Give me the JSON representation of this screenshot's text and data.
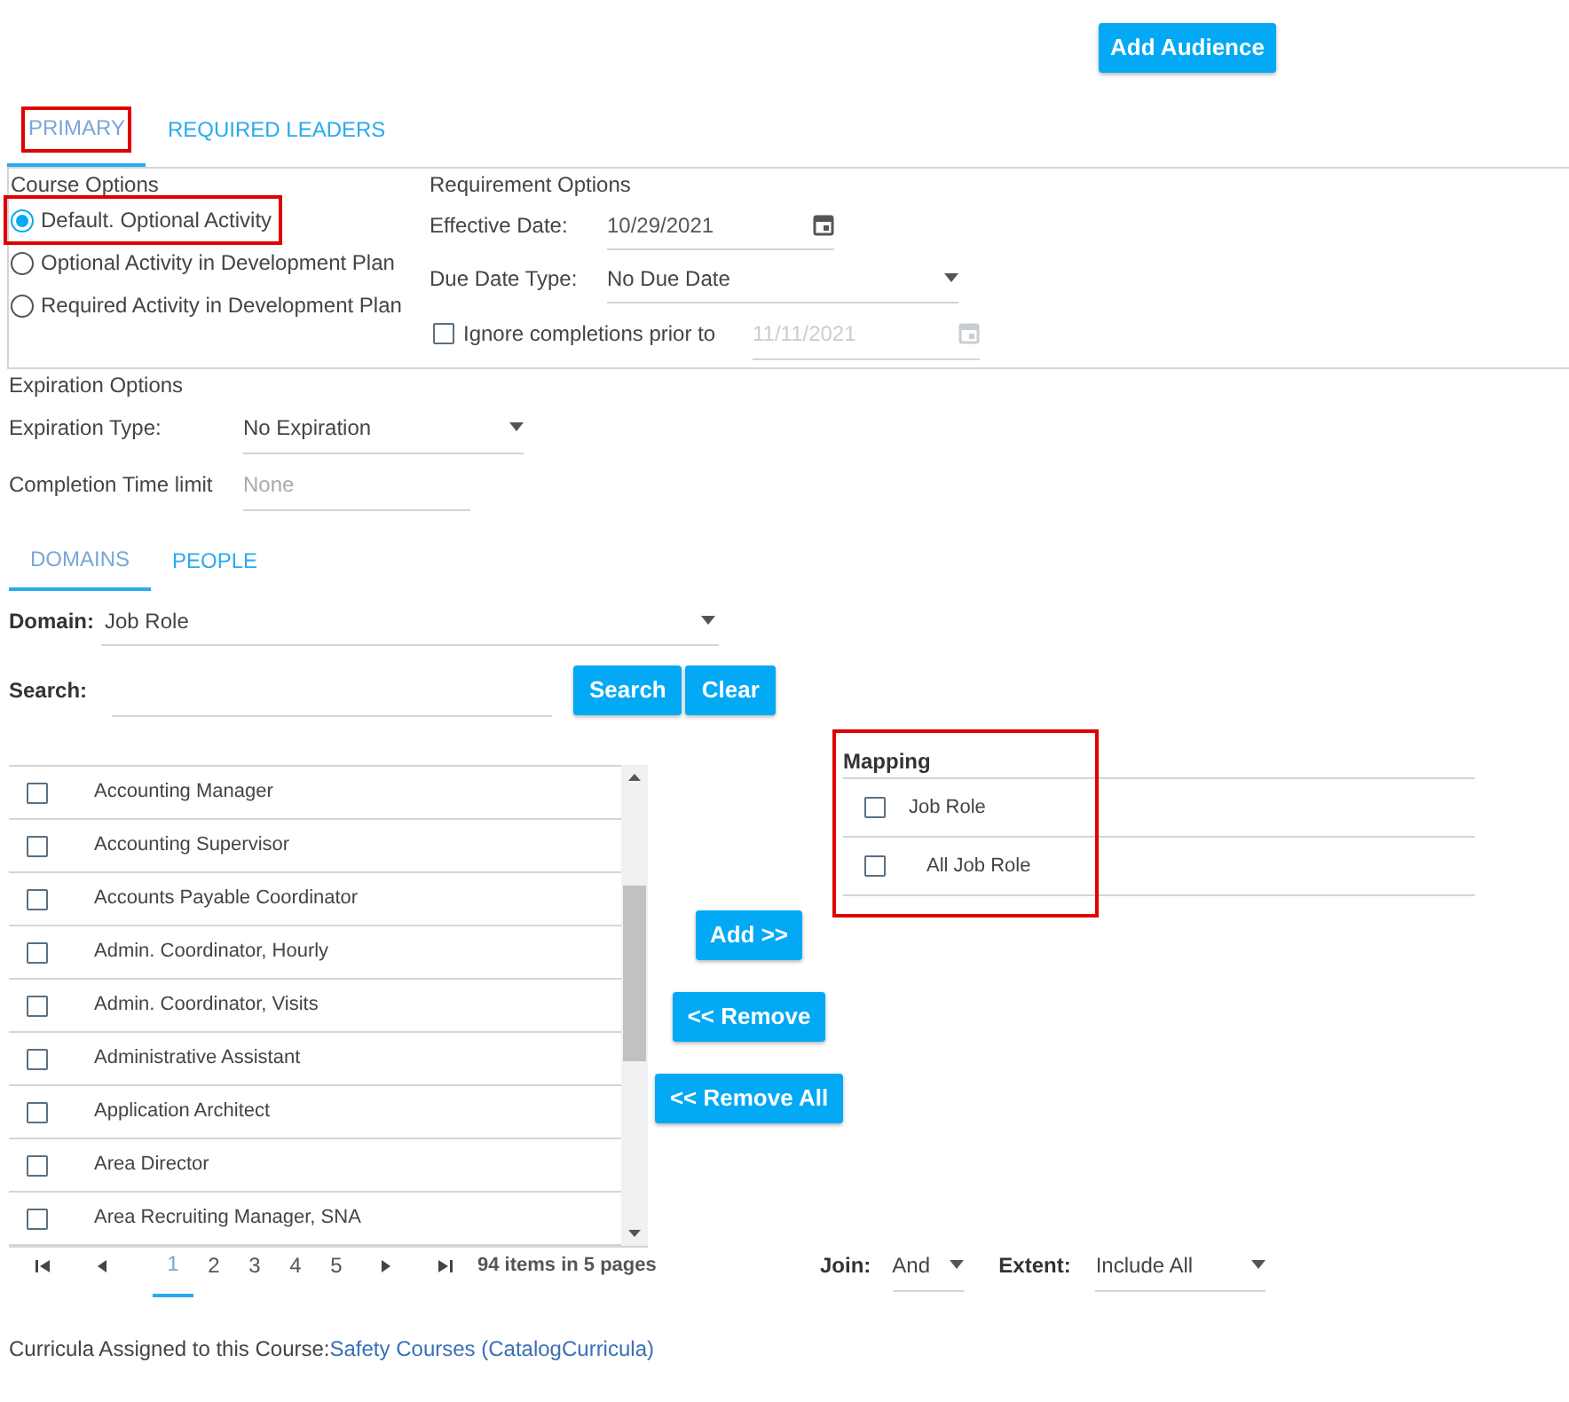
{
  "add_audience_button": "Add Audience",
  "tabs": [
    {
      "label": "PRIMARY",
      "selected": true,
      "highlighted": true
    },
    {
      "label": "REQUIRED LEADERS",
      "selected": false,
      "highlighted": false
    }
  ],
  "course_options": {
    "title": "Course Options",
    "options": [
      {
        "label": "Default. Optional Activity",
        "selected": true,
        "highlighted": true
      },
      {
        "label": "Optional Activity in Development Plan",
        "selected": false,
        "highlighted": false
      },
      {
        "label": "Required Activity in Development Plan",
        "selected": false,
        "highlighted": false
      }
    ]
  },
  "requirement_options": {
    "title": "Requirement Options",
    "effective_date": {
      "label": "Effective Date:",
      "value": "10/29/2021"
    },
    "due_date_type": {
      "label": "Due Date Type:",
      "value": "No Due Date"
    },
    "ignore_completions": {
      "label": "Ignore completions prior to",
      "checked": false,
      "value": "11/11/2021",
      "disabled": true
    }
  },
  "expiration_options": {
    "title": "Expiration Options",
    "expiration_type": {
      "label": "Expiration Type:",
      "value": "No Expiration"
    },
    "completion_time_limit": {
      "label": "Completion Time limit",
      "placeholder": "None"
    }
  },
  "sub_tabs": [
    {
      "label": "DOMAINS",
      "selected": true
    },
    {
      "label": "PEOPLE",
      "selected": false
    }
  ],
  "domain": {
    "label": "Domain:",
    "value": "Job Role"
  },
  "search": {
    "label": "Search:",
    "buttons": [
      "Search",
      "Clear"
    ]
  },
  "available_items": [
    {
      "label": "Accounting Manager",
      "checked": false
    },
    {
      "label": "Accounting Supervisor",
      "checked": false
    },
    {
      "label": "Accounts Payable Coordinator",
      "checked": false
    },
    {
      "label": "Admin. Coordinator, Hourly",
      "checked": false
    },
    {
      "label": "Admin. Coordinator, Visits",
      "checked": false
    },
    {
      "label": "Administrative Assistant",
      "checked": false
    },
    {
      "label": "Application Architect",
      "checked": false
    },
    {
      "label": "Area Director",
      "checked": false
    },
    {
      "label": "Area Recruiting Manager, SNA",
      "checked": false
    }
  ],
  "transfer_buttons": [
    "Add >>",
    "<< Remove",
    "<< Remove All"
  ],
  "mapping": {
    "title": "Mapping",
    "highlighted": true,
    "items": [
      {
        "label": "Job Role",
        "checked": false,
        "children": [
          {
            "label": "All Job Role",
            "checked": false
          }
        ]
      }
    ]
  },
  "pager": {
    "pages": [
      {
        "label": "1",
        "selected": true
      },
      {
        "label": "2",
        "selected": false
      },
      {
        "label": "3",
        "selected": false
      },
      {
        "label": "4",
        "selected": false
      },
      {
        "label": "5",
        "selected": false
      }
    ],
    "summary": "94 items in 5 pages"
  },
  "join": {
    "label": "Join:",
    "value": "And"
  },
  "extent": {
    "label": "Extent:",
    "value": "Include All"
  },
  "footer": {
    "label": "Curricula Assigned to this Course:",
    "link": "Safety Courses (CatalogCurricula)"
  }
}
